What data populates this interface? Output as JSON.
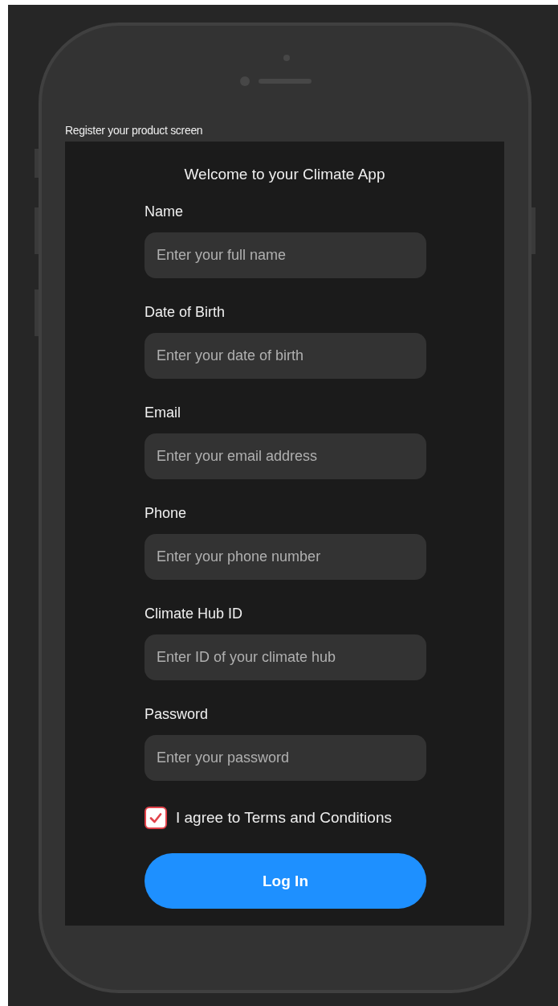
{
  "frame_label": "Register your product screen",
  "title": "Welcome to your Climate App",
  "fields": [
    {
      "label": "Name",
      "placeholder": "Enter your full name"
    },
    {
      "label": "Date of Birth",
      "placeholder": "Enter your date of birth"
    },
    {
      "label": "Email",
      "placeholder": "Enter your email address"
    },
    {
      "label": "Phone",
      "placeholder": "Enter your phone number"
    },
    {
      "label": "Climate Hub ID",
      "placeholder": "Enter ID of your climate hub"
    },
    {
      "label": "Password",
      "placeholder": "Enter your password"
    }
  ],
  "terms": {
    "label": "I agree to Terms and Conditions",
    "checked": true
  },
  "button": "Log In"
}
